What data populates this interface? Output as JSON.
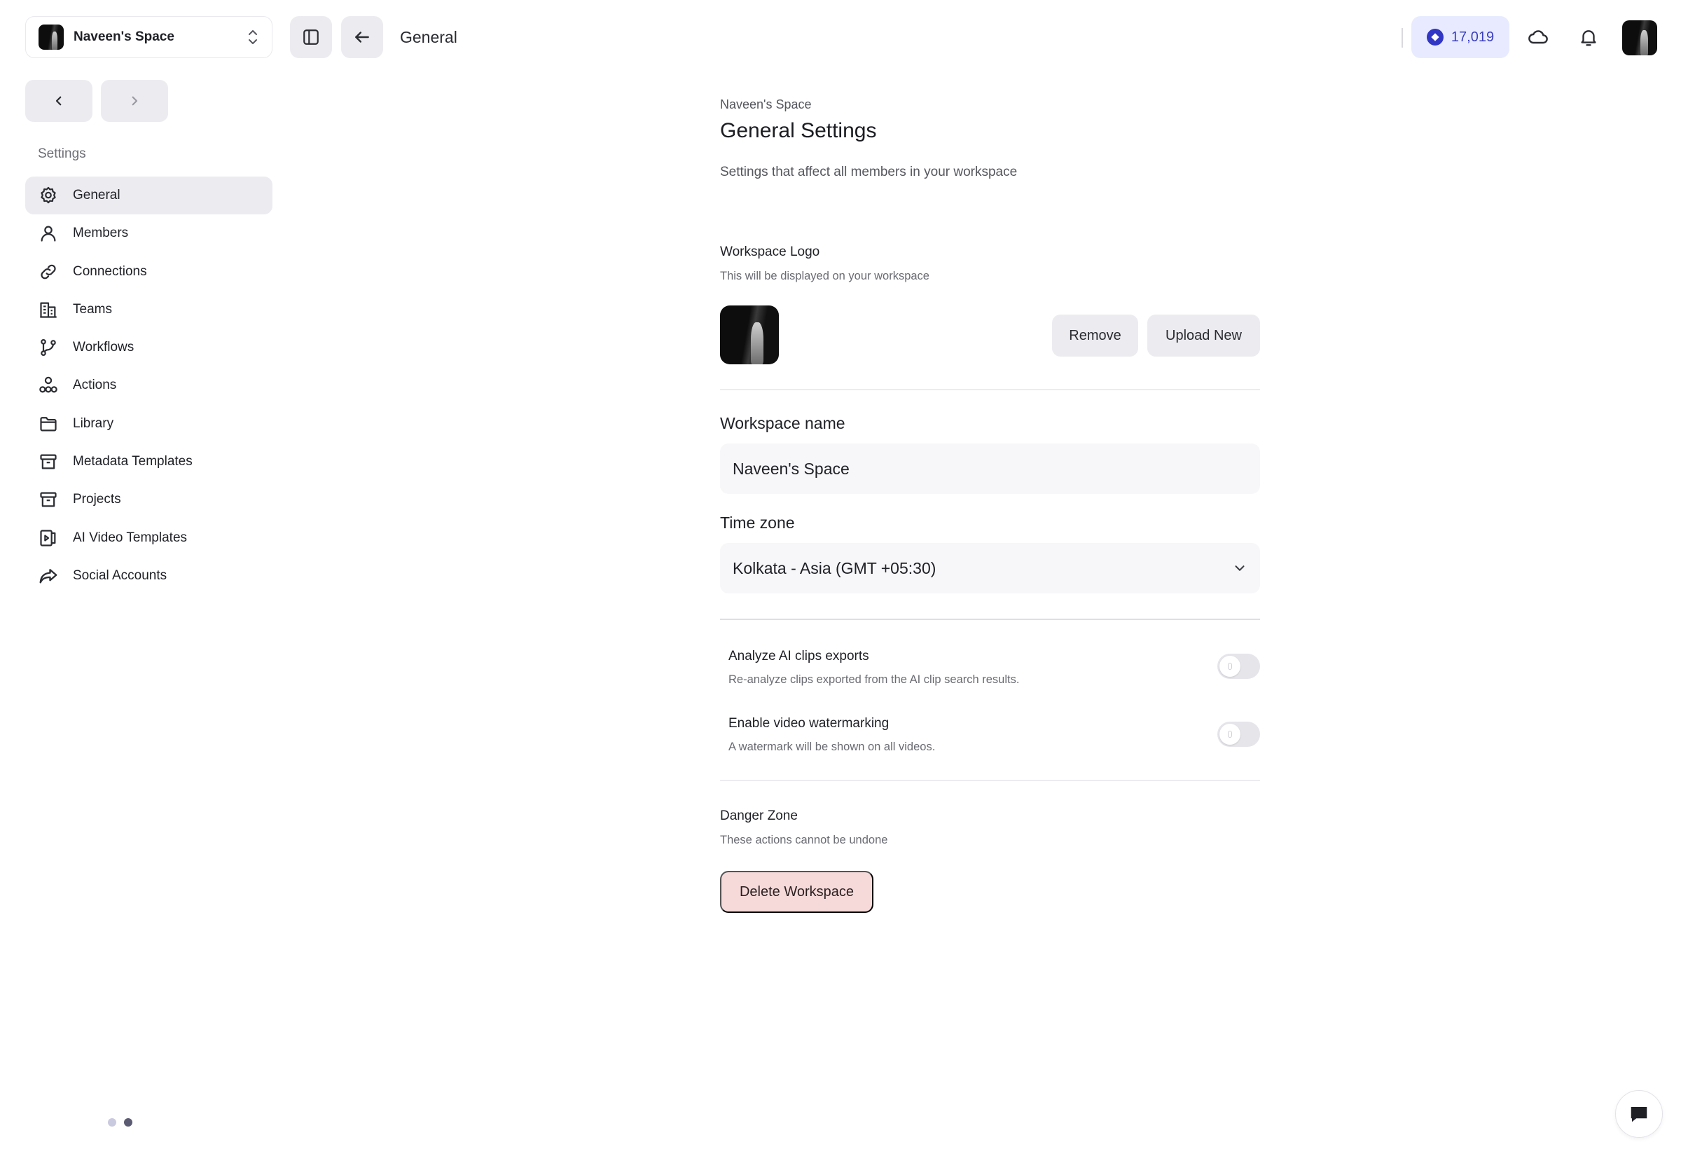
{
  "workspace_switcher": {
    "name": "Naveen's Space"
  },
  "topbar": {
    "title": "General",
    "credits": "17,019"
  },
  "sidebar": {
    "section_label": "Settings",
    "items": [
      {
        "label": "General",
        "icon": "gear-icon",
        "active": true
      },
      {
        "label": "Members",
        "icon": "user-icon"
      },
      {
        "label": "Connections",
        "icon": "link-icon"
      },
      {
        "label": "Teams",
        "icon": "building-icon"
      },
      {
        "label": "Workflows",
        "icon": "git-branch-icon"
      },
      {
        "label": "Actions",
        "icon": "actions-icon"
      },
      {
        "label": "Library",
        "icon": "folder-icon"
      },
      {
        "label": "Metadata Templates",
        "icon": "archive-icon"
      },
      {
        "label": "Projects",
        "icon": "archive-icon"
      },
      {
        "label": "AI Video Templates",
        "icon": "video-template-icon"
      },
      {
        "label": "Social Accounts",
        "icon": "share-icon"
      }
    ]
  },
  "main": {
    "breadcrumb": "Naveen's Space",
    "title": "General Settings",
    "subtitle": "Settings that affect all members in your workspace",
    "logo": {
      "title": "Workspace Logo",
      "subtitle": "This will be displayed on your workspace",
      "remove_label": "Remove",
      "upload_label": "Upload New"
    },
    "name_field": {
      "label": "Workspace name",
      "value": "Naveen's Space"
    },
    "timezone_field": {
      "label": "Time zone",
      "value": "Kolkata - Asia (GMT +05:30)"
    },
    "toggles": [
      {
        "title": "Analyze AI clips exports",
        "subtitle": "Re-analyze clips exported from the AI clip search results.",
        "on": false
      },
      {
        "title": "Enable video watermarking",
        "subtitle": "A watermark will be shown on all videos.",
        "on": false
      }
    ],
    "danger": {
      "title": "Danger Zone",
      "subtitle": "These actions cannot be undone",
      "delete_label": "Delete Workspace"
    }
  },
  "colors": {
    "accent": "#3236c4",
    "credits_bg": "#e8ebff",
    "danger_bg": "#f6dada",
    "surface": "#ececf0"
  },
  "pager": {
    "count": 2,
    "active": 1
  }
}
